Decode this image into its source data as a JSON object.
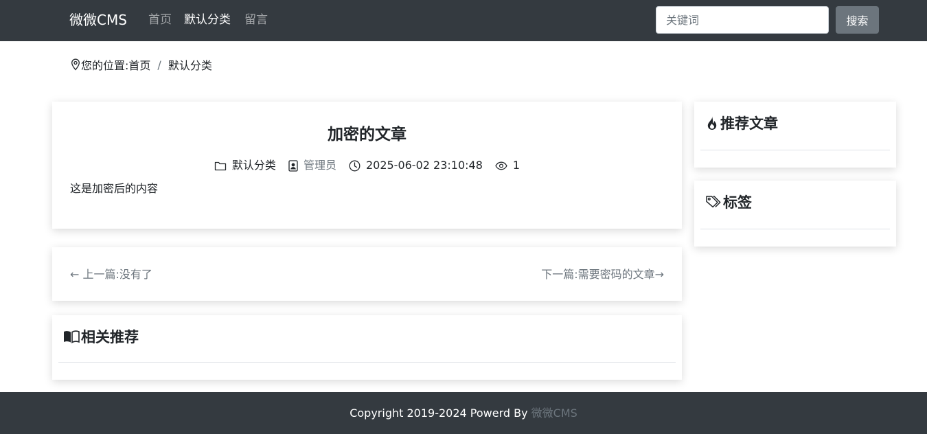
{
  "navbar": {
    "brand": "微微CMS",
    "links": [
      {
        "label": "首页",
        "active": false
      },
      {
        "label": "默认分类",
        "active": true
      },
      {
        "label": "留言",
        "active": false
      }
    ],
    "search_placeholder": "关键词",
    "search_button": "搜索"
  },
  "breadcrumb": {
    "prefix": "您的位置:",
    "items": [
      "首页",
      "默认分类"
    ],
    "icon": "map-pin-icon"
  },
  "article": {
    "title": "加密的文章",
    "category": "默认分类",
    "author": "管理员",
    "datetime": "2025-06-02 23:10:48",
    "views": "1",
    "body": "这是加密后的内容"
  },
  "prev_next": {
    "prev": "← 上一篇:没有了",
    "next": "下一篇:需要密码的文章→"
  },
  "related": {
    "title": "相关推荐",
    "icon": "book-icon"
  },
  "sidebar": {
    "recommended": {
      "title": "推荐文章",
      "icon": "fire-icon"
    },
    "tags": {
      "title": "标签",
      "icon": "tags-icon"
    }
  },
  "footer": {
    "text": "Copyright 2019-2024 Powerd By ",
    "link": "微微CMS"
  },
  "colors": {
    "navbar_bg": "#343a40",
    "muted": "#6c757d",
    "button": "#6c757d"
  }
}
